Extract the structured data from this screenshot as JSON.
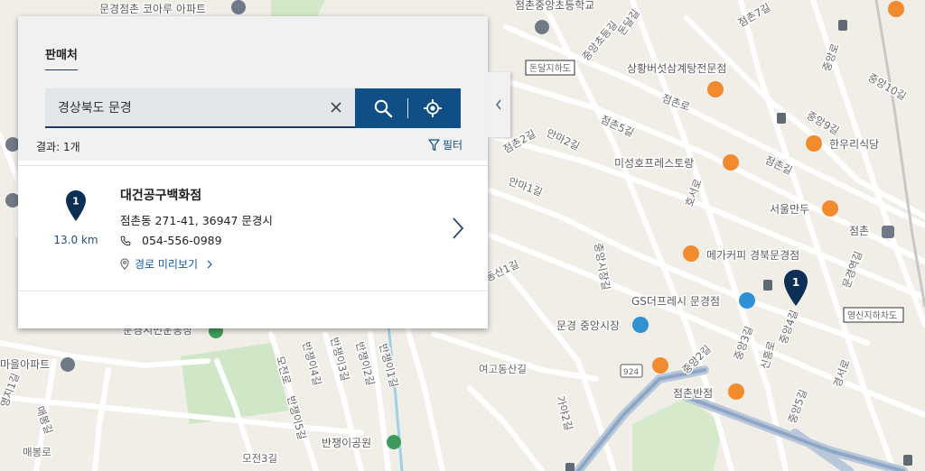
{
  "panel": {
    "tab_label": "판매처",
    "search": {
      "value": "경상북도 문경",
      "placeholder": ""
    },
    "result_count": "결과: 1개",
    "filter_label": "필터",
    "results": [
      {
        "number": "1",
        "distance": "13.0 km",
        "name": "대건공구백화점",
        "address": "점촌동 271-41, 36947 문경시",
        "phone": "054-556-0989",
        "route_label": "경로 미리보기"
      }
    ]
  },
  "map": {
    "marker_number": "1",
    "labels": {
      "apartment_top": "문경점촌 코아루 아파트",
      "school": "점촌중앙초등학교",
      "underpass_dondal": "돈달지하도",
      "dondalgil": "돈달길",
      "jungang_school_gil": "중앙초등길",
      "jeomchon_7gil": "점촌7길",
      "sanghwang": "상황버섯삼계탕전문점",
      "jungangro": "중앙로",
      "jungang_10gil": "중앙10길",
      "jeomchonro": "점촌로",
      "jungang_9gil": "중앙9길",
      "jeomchon_5gil": "점촌5길",
      "hanuri": "한우리식당",
      "anma_2gil": "안마2길",
      "misung": "미성호프레스토랑",
      "jeomchongil": "점촌길",
      "anma_1gil": "안마1길",
      "hoseoro": "호서로",
      "seoul_mandu": "서울만두",
      "jeomchon_station": "점촌",
      "mega_coffee": "메가커피 경북문경점",
      "jungang_sijang_gil": "중앙시장길",
      "dongsan_1gil": "동산1길",
      "gs_fresh": "GS더프레시 문경점",
      "mungyeong_market": "문경 중앙시장",
      "yeongsin_underpass": "영신지하차도",
      "jungang_4gil": "중앙4길",
      "jungang_3gil": "중앙3길",
      "jungang_2gil": "중앙2길",
      "sinheungro": "신흥로",
      "park_name": "문경시민운동장",
      "apartment_left": "마을아파트",
      "moranro": "모전로",
      "banjeongi_4gil": "반쟁이4길",
      "banjeongi_3gil": "반쟁이3길",
      "banjeongi_2gil": "반쟁이2길",
      "banjeongi_1gil": "반쟁이1길",
      "banjeongi_5gil": "반쟁이5길",
      "yeogo_dongsan": "여고동산길",
      "road_924": "924",
      "gagopgil": "가야2길",
      "jeomchon_banjeom": "점촌반점",
      "jungang_5gil": "중앙5길",
      "gyeongseoro": "경서로",
      "yongji_1gil": "영지1길",
      "maebong_gil": "매봉길",
      "maebongro": "매봉로",
      "mojeon_3gil": "모전3길",
      "banjeongi_park": "반쟁이공원",
      "jeomchon_2gil": "점촌2길",
      "mungyeong_station_road": "문경역길"
    }
  }
}
